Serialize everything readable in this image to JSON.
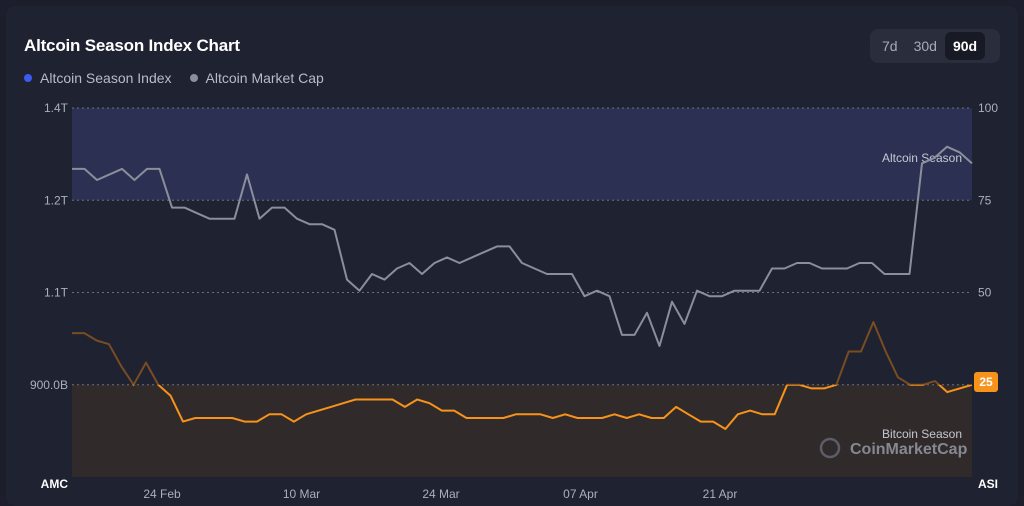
{
  "title": "Altcoin Season Index Chart",
  "legend": [
    {
      "label": "Altcoin Season Index",
      "color": "#3c5bf0"
    },
    {
      "label": "Altcoin Market Cap",
      "color": "#8a8f9c"
    }
  ],
  "range_buttons": [
    "7d",
    "30d",
    "90d"
  ],
  "active_range": "90d",
  "watermark": "CoinMarketCap",
  "chart_data": {
    "type": "line",
    "left_axis": {
      "name": "AMC",
      "ticks": [
        "1.4T",
        "1.2T",
        "1.1T",
        "900.0B"
      ]
    },
    "right_axis": {
      "name": "ASI",
      "ticks": [
        "100",
        "75",
        "50",
        "25"
      ],
      "ylim": [
        0,
        100
      ]
    },
    "x_ticks": [
      "24 Feb",
      "10 Mar",
      "24 Mar",
      "07 Apr",
      "21 Apr"
    ],
    "bands": [
      {
        "label": "Altcoin Season",
        "from": 75,
        "to": 100
      },
      {
        "label": "Bitcoin Season",
        "from": 0,
        "to": 25
      }
    ],
    "current_value": "25",
    "series": [
      {
        "name": "Altcoin Market Cap",
        "color": "#8a8f9c",
        "values": [
          1.29,
          1.29,
          1.27,
          1.28,
          1.29,
          1.27,
          1.29,
          1.29,
          1.22,
          1.22,
          1.21,
          1.2,
          1.2,
          1.2,
          1.28,
          1.2,
          1.22,
          1.22,
          1.2,
          1.19,
          1.19,
          1.18,
          1.09,
          1.07,
          1.1,
          1.09,
          1.11,
          1.12,
          1.1,
          1.12,
          1.13,
          1.12,
          1.13,
          1.14,
          1.15,
          1.15,
          1.12,
          1.11,
          1.1,
          1.1,
          1.1,
          1.06,
          1.07,
          1.06,
          0.99,
          0.99,
          1.03,
          0.97,
          1.05,
          1.01,
          1.07,
          1.06,
          1.06,
          1.07,
          1.07,
          1.07,
          1.11,
          1.11,
          1.12,
          1.12,
          1.11,
          1.11,
          1.11,
          1.12,
          1.12,
          1.1,
          1.1,
          1.1,
          1.3,
          1.31,
          1.33,
          1.32,
          1.3
        ]
      },
      {
        "name": "Altcoin Season Index",
        "color": "#f7931a",
        "values": [
          39,
          39,
          37,
          36,
          30,
          25,
          31,
          25,
          22,
          15,
          16,
          16,
          16,
          16,
          15,
          15,
          17,
          17,
          15,
          17,
          18,
          19,
          20,
          21,
          21,
          21,
          21,
          19,
          21,
          20,
          18,
          18,
          16,
          16,
          16,
          16,
          17,
          17,
          17,
          16,
          17,
          16,
          16,
          16,
          17,
          16,
          17,
          16,
          16,
          19,
          17,
          15,
          15,
          13,
          17,
          18,
          17,
          17,
          25,
          25,
          24,
          24,
          25,
          34,
          34,
          42,
          34,
          27,
          25,
          25,
          26,
          23,
          24,
          25
        ]
      }
    ]
  }
}
